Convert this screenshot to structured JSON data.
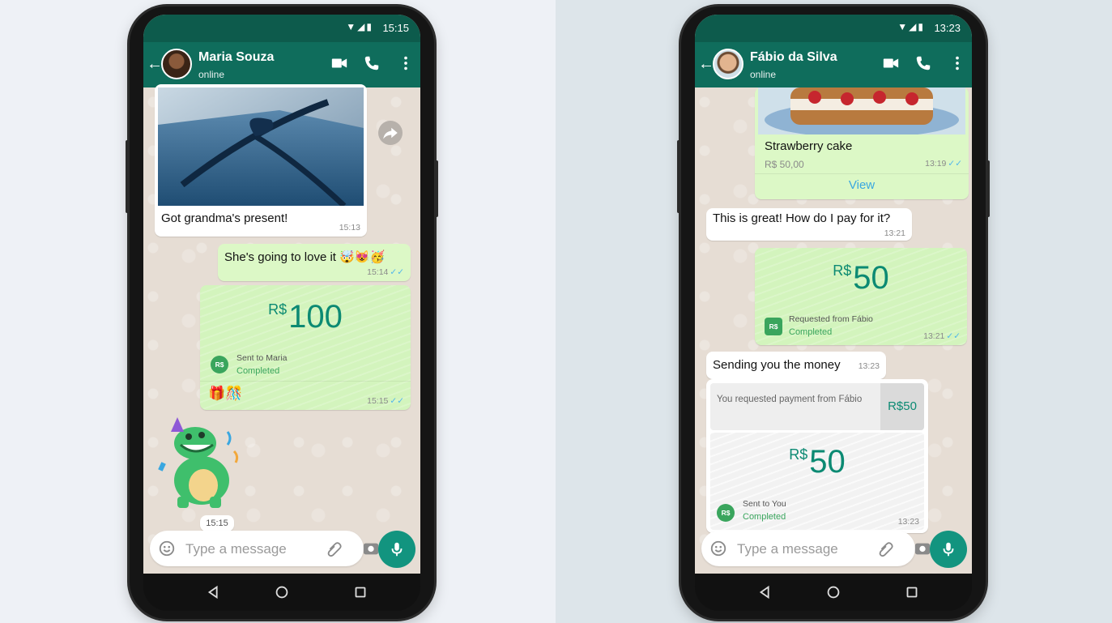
{
  "left_phone": {
    "status": {
      "time": "15:15"
    },
    "header": {
      "contact_name": "Maria Souza",
      "status_text": "online"
    },
    "messages": {
      "gift": {
        "caption": "Got grandma's present!",
        "time": "15:13"
      },
      "love": {
        "text": "She's going to love it 🤯😻🥳",
        "time": "15:14"
      },
      "payment": {
        "currency": "R$",
        "amount": "100",
        "line1": "Sent to Maria",
        "line2": "Completed",
        "emoji_caption": "🎁🎊",
        "time": "15:15"
      },
      "sticker": {
        "time": "15:15"
      }
    },
    "input": {
      "placeholder": "Type a message"
    }
  },
  "right_phone": {
    "status": {
      "time": "13:23"
    },
    "header": {
      "contact_name": "Fábio da Silva",
      "status_text": "online"
    },
    "messages": {
      "product": {
        "name": "Strawberry cake",
        "price": "R$ 50,00",
        "time": "13:19",
        "view_label": "View"
      },
      "question": {
        "text": "This is great! How do I pay for it?",
        "time": "13:21"
      },
      "request": {
        "currency": "R$",
        "amount": "50",
        "line1": "Requested from Fábio",
        "line2": "Completed",
        "time": "13:21"
      },
      "sending": {
        "text": "Sending you the money",
        "time": "13:23"
      },
      "quoted": {
        "text": "You requested payment from Fábio",
        "amount": "R$50"
      },
      "sent": {
        "currency": "R$",
        "amount": "50",
        "line1": "Sent to You",
        "line2": "Completed",
        "time": "13:23"
      }
    },
    "input": {
      "placeholder": "Type a message"
    }
  },
  "badge_label": "R$",
  "colors": {
    "header": "#0f6d5c",
    "statusbar": "#0d5b4c",
    "outgoing_bubble": "#dcf8c6",
    "payment_bubble": "#d3f4bd",
    "amount_text": "#0c8a73",
    "read_ticks": "#4fb6ec",
    "mic_button": "#12947f"
  },
  "icons": [
    "back-arrow-icon",
    "video-call-icon",
    "phone-call-icon",
    "more-vert-icon",
    "forward-icon",
    "emoji-icon",
    "attach-icon",
    "camera-icon",
    "mic-icon",
    "nav-back-icon",
    "nav-home-icon",
    "nav-recents-icon"
  ]
}
